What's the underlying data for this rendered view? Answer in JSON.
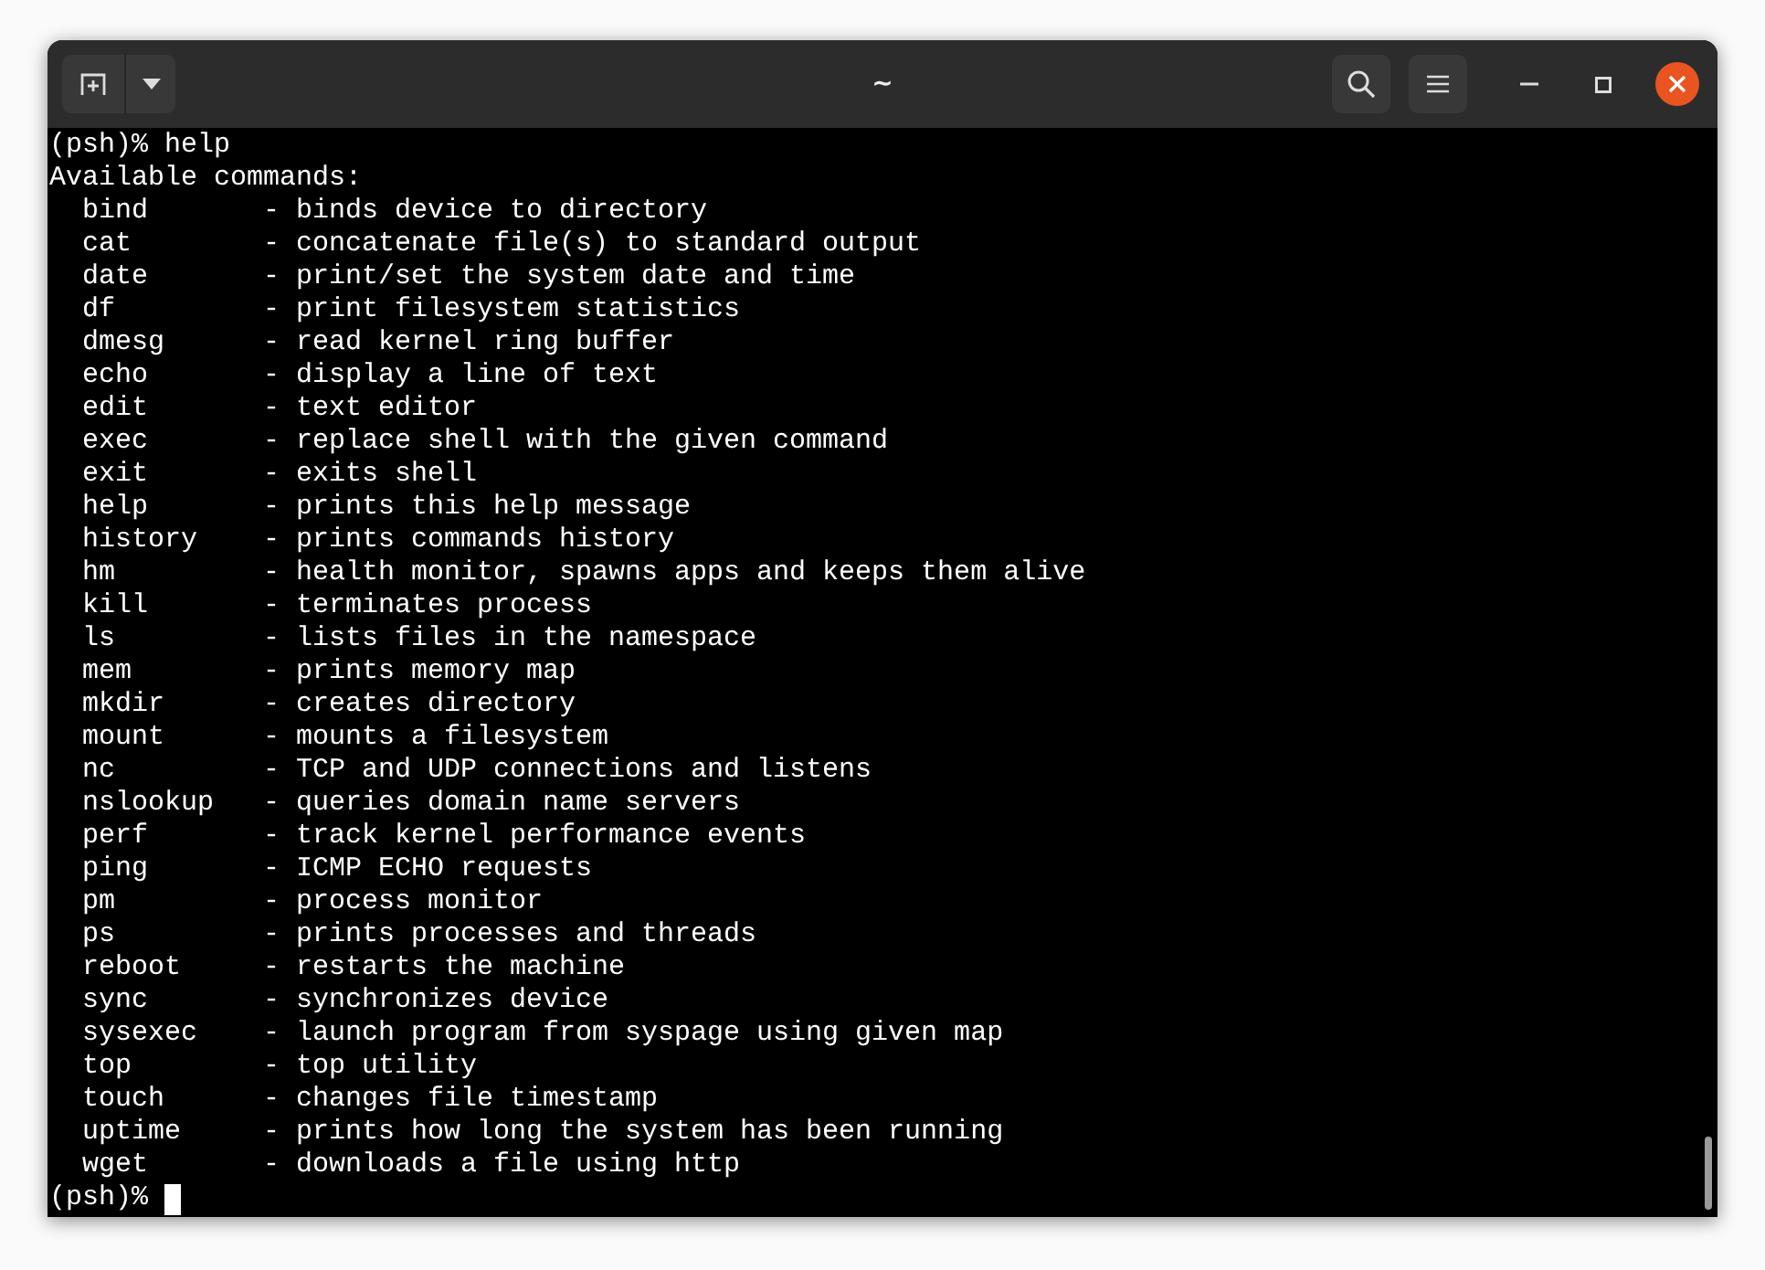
{
  "window": {
    "title": "~"
  },
  "terminal": {
    "command_prompt": "(psh)%",
    "command": "help",
    "heading": "Available commands:",
    "commands": [
      {
        "name": "bind",
        "description": "- binds device to directory"
      },
      {
        "name": "cat",
        "description": "- concatenate file(s) to standard output"
      },
      {
        "name": "date",
        "description": "- print/set the system date and time"
      },
      {
        "name": "df",
        "description": "- print filesystem statistics"
      },
      {
        "name": "dmesg",
        "description": "- read kernel ring buffer"
      },
      {
        "name": "echo",
        "description": "- display a line of text"
      },
      {
        "name": "edit",
        "description": "- text editor"
      },
      {
        "name": "exec",
        "description": "- replace shell with the given command"
      },
      {
        "name": "exit",
        "description": "- exits shell"
      },
      {
        "name": "help",
        "description": "- prints this help message"
      },
      {
        "name": "history",
        "description": "- prints commands history"
      },
      {
        "name": "hm",
        "description": "- health monitor, spawns apps and keeps them alive"
      },
      {
        "name": "kill",
        "description": "- terminates process"
      },
      {
        "name": "ls",
        "description": "- lists files in the namespace"
      },
      {
        "name": "mem",
        "description": "- prints memory map"
      },
      {
        "name": "mkdir",
        "description": "- creates directory"
      },
      {
        "name": "mount",
        "description": "- mounts a filesystem"
      },
      {
        "name": "nc",
        "description": "- TCP and UDP connections and listens"
      },
      {
        "name": "nslookup",
        "description": "- queries domain name servers"
      },
      {
        "name": "perf",
        "description": "- track kernel performance events"
      },
      {
        "name": "ping",
        "description": "- ICMP ECHO requests"
      },
      {
        "name": "pm",
        "description": "- process monitor"
      },
      {
        "name": "ps",
        "description": "- prints processes and threads"
      },
      {
        "name": "reboot",
        "description": "- restarts the machine"
      },
      {
        "name": "sync",
        "description": "- synchronizes device"
      },
      {
        "name": "sysexec",
        "description": "- launch program from syspage using given map"
      },
      {
        "name": "top",
        "description": "- top utility"
      },
      {
        "name": "touch",
        "description": "- changes file timestamp"
      },
      {
        "name": "uptime",
        "description": "- prints how long the system has been running"
      },
      {
        "name": "wget",
        "description": "- downloads a file using http"
      }
    ],
    "final_prompt": "(psh)%"
  }
}
